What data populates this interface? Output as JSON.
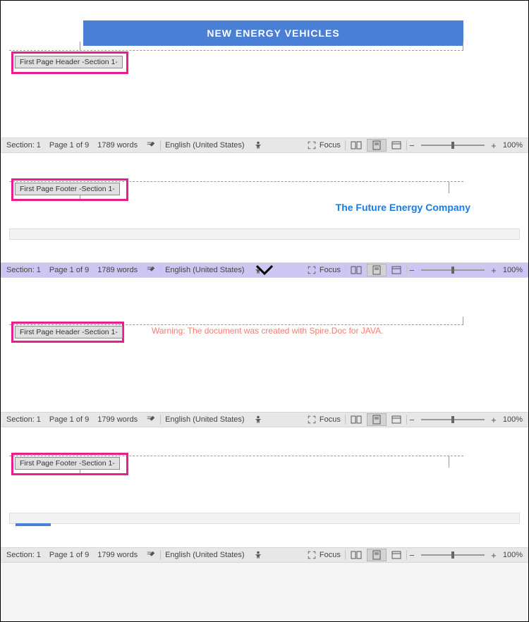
{
  "banner": {
    "title": "NEW ENERGY VEHICLES"
  },
  "labels": {
    "header": "First Page Header -Section 1-",
    "footer": "First Page Footer -Section 1-"
  },
  "panel2": {
    "footer_text": "The Future Energy Company"
  },
  "panel3": {
    "warning": "Warning: The document was created with Spire.Doc for JAVA."
  },
  "statusbars": [
    {
      "section": "Section: 1",
      "page": "Page 1 of 9",
      "words": "1789 words",
      "lang": "English (United States)",
      "focus": "Focus",
      "zoom": "100%"
    },
    {
      "section": "Section: 1",
      "page": "Page 1 of 9",
      "words": "1789 words",
      "lang": "English (United States)",
      "focus": "Focus",
      "zoom": "100%"
    },
    {
      "section": "Section: 1",
      "page": "Page 1 of 9",
      "words": "1799 words",
      "lang": "English (United States)",
      "focus": "Focus",
      "zoom": "100%"
    },
    {
      "section": "Section: 1",
      "page": "Page 1 of 9",
      "words": "1799 words",
      "lang": "English (United States)",
      "focus": "Focus",
      "zoom": "100%"
    }
  ]
}
